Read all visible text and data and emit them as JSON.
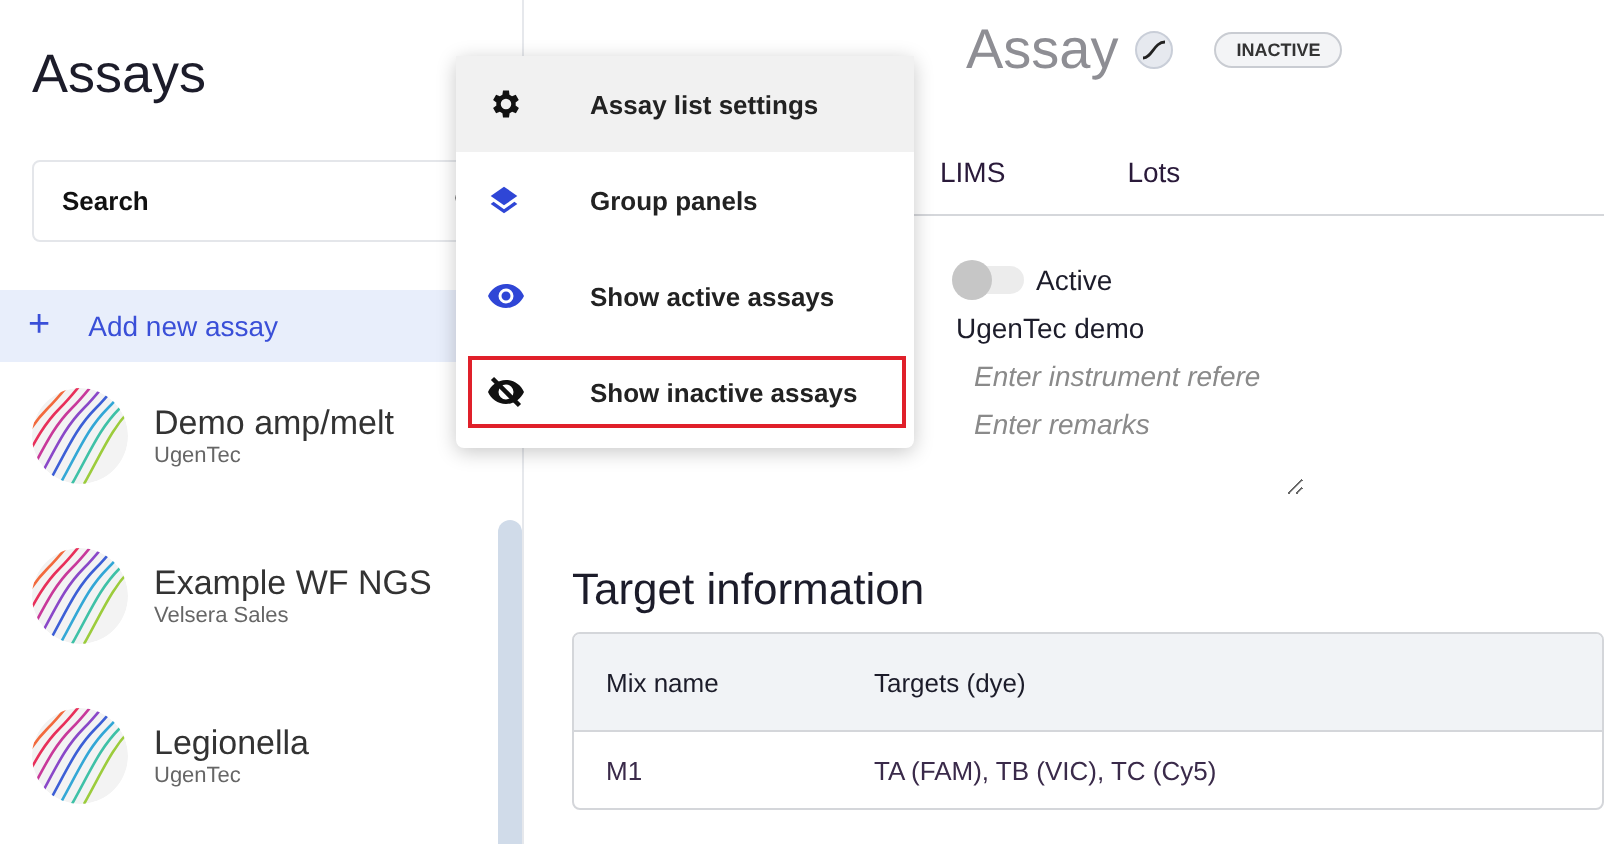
{
  "sidebar": {
    "title": "Assays",
    "search": {
      "placeholder": "Search"
    },
    "add_button": {
      "icon": "+",
      "label": "Add new assay"
    },
    "assays": [
      {
        "name": "Demo amp/melt",
        "owner": "UgenTec"
      },
      {
        "name": "Example WF NGS",
        "owner": "Velsera Sales"
      },
      {
        "name": "Legionella",
        "owner": "UgenTec"
      }
    ]
  },
  "header": {
    "title": "Assay",
    "status_badge": "INACTIVE"
  },
  "tabs": [
    {
      "label": "LIMS"
    },
    {
      "label": "Lots"
    }
  ],
  "form": {
    "active_toggle": {
      "label": "Active",
      "on": false
    },
    "organization": "UgenTec demo",
    "instrument_reference": {
      "placeholder": "Enter instrument refere"
    },
    "remarks": {
      "placeholder": "Enter remarks"
    }
  },
  "target_information": {
    "title": "Target information",
    "columns": [
      "Mix name",
      "Targets (dye)"
    ],
    "rows": [
      [
        "M1",
        "TA (FAM), TB (VIC), TC (Cy5)"
      ]
    ]
  },
  "menu": {
    "items": [
      {
        "kind": "settings",
        "label": "Assay list settings",
        "hovered": true,
        "outlined": false
      },
      {
        "kind": "layers",
        "label": "Group panels",
        "hovered": false,
        "outlined": false
      },
      {
        "kind": "eye",
        "label": "Show active assays",
        "hovered": false,
        "outlined": false
      },
      {
        "kind": "eye-off",
        "label": "Show inactive assays",
        "hovered": false,
        "outlined": true
      }
    ]
  }
}
